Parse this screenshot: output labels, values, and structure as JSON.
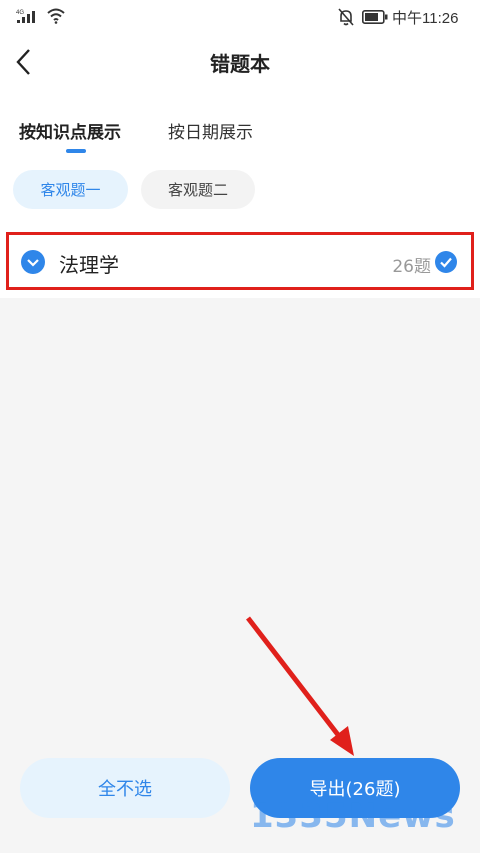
{
  "status_bar": {
    "network": "4G",
    "time": "中午11:26"
  },
  "header": {
    "title": "错题本"
  },
  "tabs": [
    {
      "label": "按知识点展示",
      "active": true
    },
    {
      "label": "按日期展示",
      "active": false
    }
  ],
  "chips": [
    {
      "label": "客观题一",
      "selected": true
    },
    {
      "label": "客观题二",
      "selected": false
    }
  ],
  "category": {
    "name": "法理学",
    "count": "26题",
    "checked": true
  },
  "buttons": {
    "deselect_all": "全不选",
    "export": "导出(26题)"
  },
  "watermark": "1335News",
  "colors": {
    "accent": "#2f86e9",
    "highlight_border": "#e0201b",
    "background": "#f5f5f5"
  }
}
